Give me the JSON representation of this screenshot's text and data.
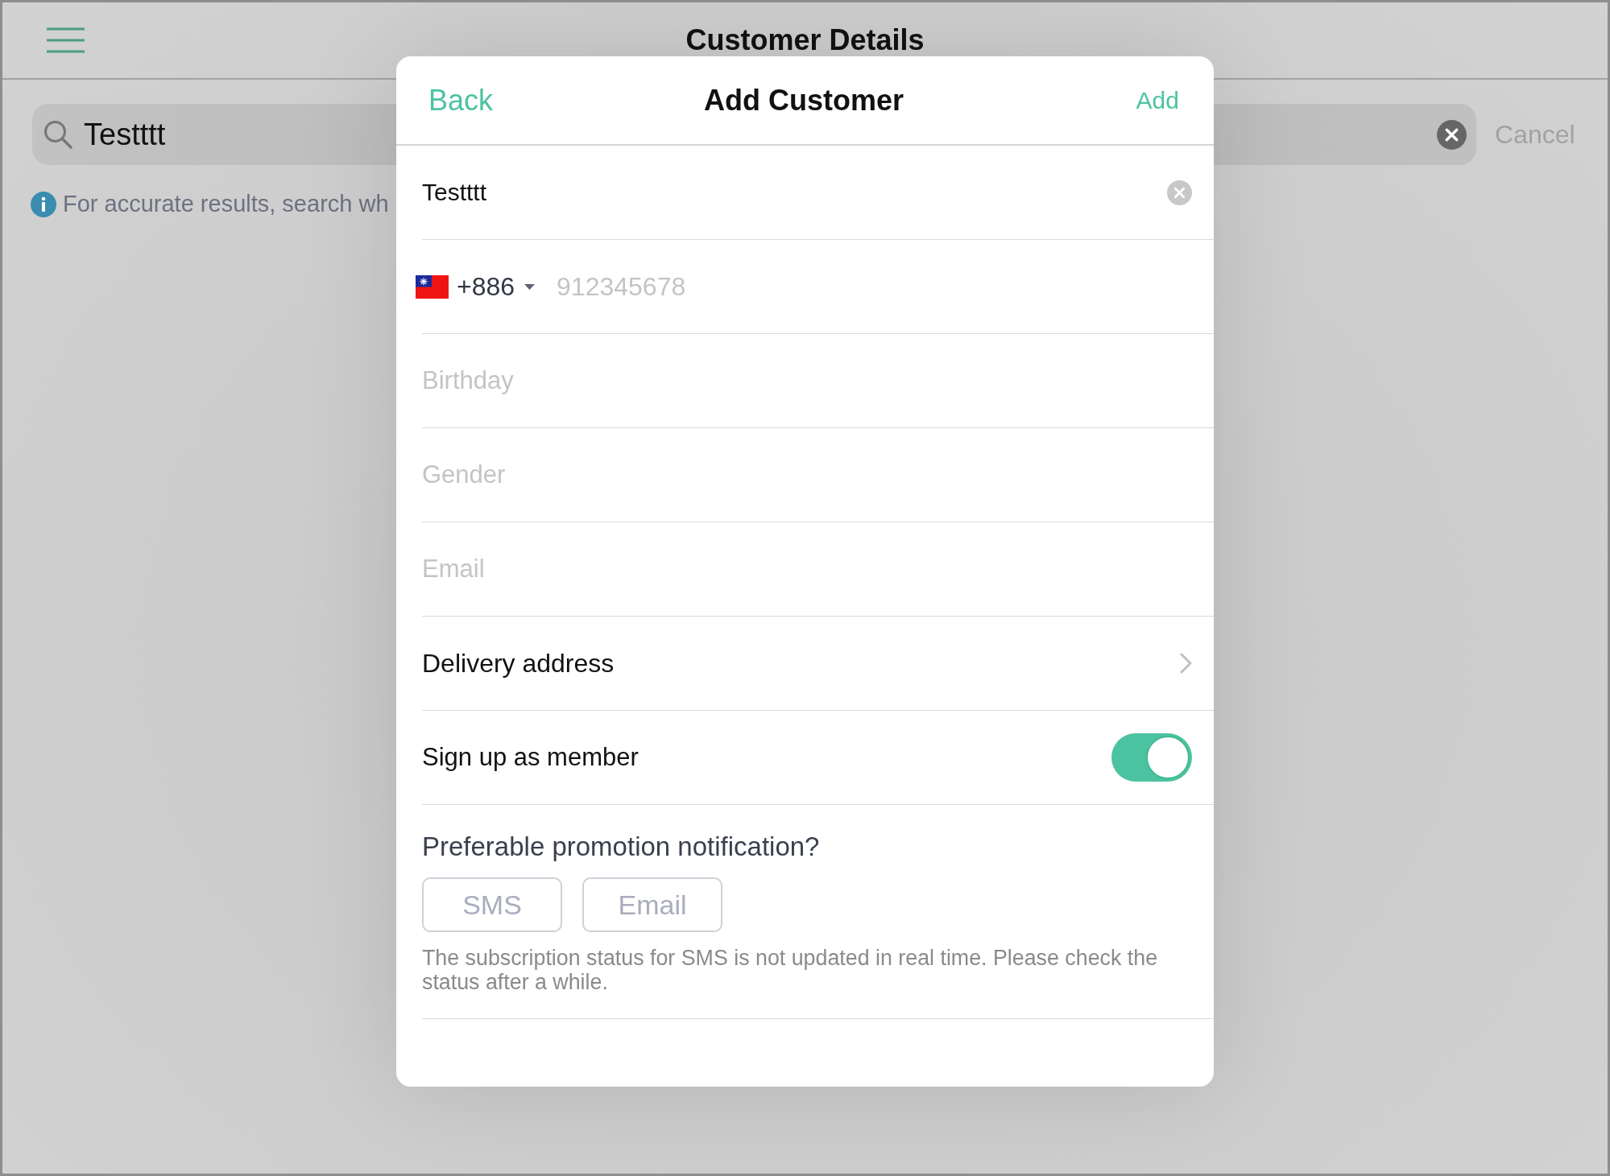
{
  "header": {
    "title": "Customer Details"
  },
  "search": {
    "value": "Testttt",
    "cancel": "Cancel"
  },
  "hint": {
    "text": "For accurate results, search wh"
  },
  "dialog": {
    "back": "Back",
    "title": "Add Customer",
    "add": "Add",
    "fields": [
      {
        "kind": "text",
        "value": "Testttt"
      },
      {
        "kind": "phone",
        "country_code": "+886",
        "placeholder": "912345678"
      },
      {
        "kind": "text",
        "placeholder": "Birthday"
      },
      {
        "kind": "text",
        "placeholder": "Gender"
      },
      {
        "kind": "text",
        "placeholder": "Email"
      },
      {
        "kind": "link",
        "label": "Delivery address"
      },
      {
        "kind": "toggle",
        "label": "Sign up as member",
        "on": true
      }
    ],
    "promotion": {
      "question": "Preferable promotion notification?",
      "options": [
        {
          "label": "SMS",
          "selected": false
        },
        {
          "label": "Email",
          "selected": false
        }
      ],
      "note": "The subscription status for SMS is not updated in real time. Please check the status after a while."
    }
  }
}
